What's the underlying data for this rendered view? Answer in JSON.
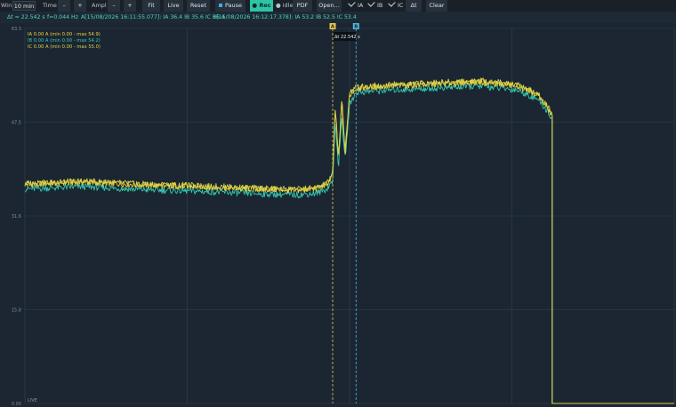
{
  "toolbar": {
    "win_label": "Win",
    "win_value": "10 min",
    "time_label": "Time",
    "time_minus": "–",
    "time_plus": "+",
    "ampl_label": "Ampl",
    "ampl_minus": "–",
    "ampl_plus": "+",
    "fit": "Fit",
    "live": "Live",
    "reset": "Reset",
    "pause": "Pause",
    "rec": "● Rec",
    "idle": "● idle",
    "pdf": "PDF",
    "open": "Open...",
    "ia": "IA",
    "ib": "IB",
    "ic": "IC",
    "delta": "Δt",
    "clear": "Clear"
  },
  "status": {
    "delta": "Δt = 22.542 s",
    "freq": "f=0.044 Hz",
    "cursor_a": "A[15/08/2026 16:11:55.077]: IA 36.4 IB 35.6 IC 36.4",
    "cursor_b": "B[15/08/2026 16:12:17.378]: IA 53.2 IB 52.5 IC 53.4"
  },
  "colors": {
    "IA": "#f0d23c",
    "IB": "#34c9b0",
    "IC": "#d7d348",
    "cursor_a": "#e8c94a",
    "cursor_b": "#4fb8d8",
    "grid": "#34414e"
  },
  "chart_data": {
    "type": "line",
    "xlabel": "",
    "ylabel": "",
    "ylim": [
      0.0,
      63.3
    ],
    "y_ticks": [
      "63.3",
      "47.5",
      "31.6",
      "15.8",
      "0.00"
    ],
    "grid": true,
    "legend_position": "top-left",
    "live_label": "LIVE",
    "legend": [
      {
        "text": "IA 0.00 A   (min 0.00 - max 54.9)",
        "color": "#f0d23c"
      },
      {
        "text": "IB 0.00 A   (min 0.00 - max 54.2)",
        "color": "#34c9b0"
      },
      {
        "text": "IC 0.00 A   (min 0.00 - max 55.0)",
        "color": "#d7d348"
      }
    ],
    "cursors": [
      {
        "label": "A",
        "x_frac": 0.474
      },
      {
        "label": "B",
        "x_frac": 0.51
      }
    ],
    "cursor_delta_label": "Δt 22.542 s",
    "x": [
      0.0,
      0.09,
      0.18,
      0.27,
      0.36,
      0.42,
      0.45,
      0.465,
      0.474,
      0.478,
      0.483,
      0.488,
      0.493,
      0.5,
      0.51,
      0.56,
      0.63,
      0.7,
      0.76,
      0.79,
      0.805,
      0.812,
      0.812,
      1.0
    ],
    "series": [
      {
        "name": "IA",
        "values": [
          37.0,
          37.4,
          36.9,
          36.6,
          36.2,
          36.0,
          36.3,
          37.0,
          38.5,
          50.0,
          41.0,
          51.0,
          42.0,
          52.0,
          53.2,
          53.6,
          53.9,
          54.3,
          53.6,
          52.0,
          50.0,
          48.5,
          0.0,
          0.0
        ]
      },
      {
        "name": "IB",
        "values": [
          36.2,
          36.6,
          36.1,
          35.8,
          35.4,
          35.2,
          35.5,
          36.2,
          37.6,
          47.5,
          40.0,
          48.5,
          41.0,
          50.5,
          52.5,
          52.9,
          53.2,
          53.6,
          52.9,
          51.3,
          49.3,
          47.8,
          0.0,
          0.0
        ]
      },
      {
        "name": "IC",
        "values": [
          37.1,
          37.5,
          37.0,
          36.7,
          36.3,
          36.1,
          36.4,
          37.1,
          38.6,
          50.5,
          41.5,
          51.5,
          42.5,
          52.5,
          53.4,
          53.8,
          54.1,
          54.5,
          53.8,
          52.2,
          50.2,
          48.7,
          0.0,
          0.0
        ]
      }
    ]
  }
}
